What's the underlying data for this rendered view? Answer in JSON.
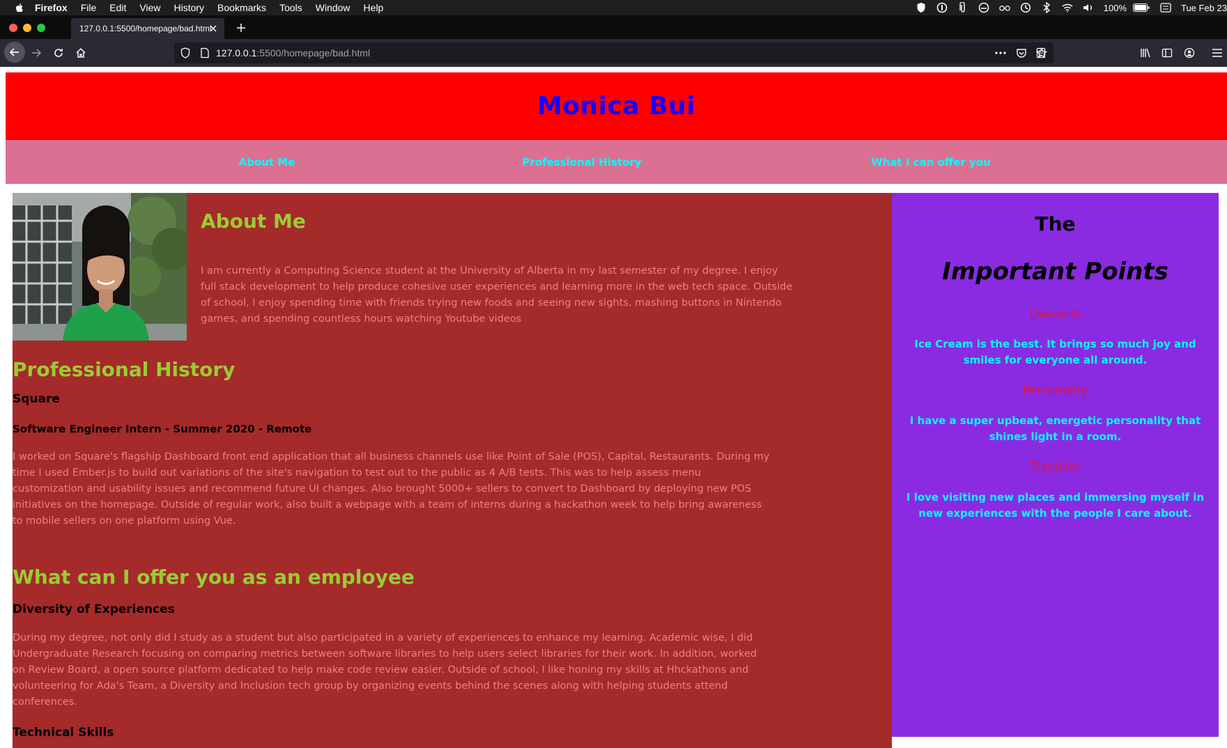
{
  "os_menubar": {
    "app_name": "Firefox",
    "menus": [
      "File",
      "Edit",
      "View",
      "History",
      "Bookmarks",
      "Tools",
      "Window",
      "Help"
    ],
    "battery_percent": "100%",
    "clock": "Tue Feb 23",
    "status_icons": [
      "ublock-icon",
      "1password-icon",
      "paperclip-icon",
      "creative-cloud-icon",
      "glasses-icon",
      "time-machine-icon",
      "bluetooth-icon",
      "wifi-icon",
      "volume-icon",
      "battery-icon",
      "keyboard-icon"
    ]
  },
  "browser": {
    "tab_title": "127.0.0.1:5500/homepage/bad.html",
    "url_host": "127.0.0.1",
    "url_rest": ":5500/homepage/bad.html"
  },
  "site": {
    "header_title": "Monica Bui",
    "nav": [
      "About Me",
      "Professional History",
      "What I can offer you"
    ],
    "about_heading": "About Me",
    "about_text": "I am currently a Computing Science student at the University of Alberta in my last semester of my degree. I enjoy full stack development to help produce cohesive user experiences and learning more in the web tech space. Outside of school, I enjoy spending time with friends trying new foods and seeing new sights, mashing buttons in Nintendo games, and spending countless hours watching Youtube videos",
    "prof_heading": "Professional History",
    "prof_company": "Square",
    "prof_role": "Software Engineer Intern - Summer 2020 - Remote",
    "prof_text": "I worked on Square's flagship Dashboard front end application that all business channels use like Point of Sale (POS), Capital, Restaurants. During my time I used Ember.js to build out variations of the site's navigation to test out to the public as 4 A/B tests. This was to help assess menu customization and usability issues and recommend future UI changes. Also brought 5000+ sellers to convert to Dashboard by deploying new POS initiatives on the homepage. Outside of regular work, also built a webpage with a team of interns during a hackathon week to help bring awareness to mobile sellers on one platform using Vue.",
    "offer_heading": "What can I offer you as an employee",
    "offer_sub": "Diversity of Experiences",
    "offer_text": "During my degree, not only did I study as a student but also participated in a variety of experiences to enhance my learning. Academic wise, I did Undergraduate Research focusing on comparing metrics between software libraries to help users select libraries for their work. In addition, worked on Review Board, a open source platform dedicated to help make code review easier. Outside of school, I like honing my skills at Hhckathons and volunteering for Ada's Team, a Diversity and Inclusion tech group by organizing events behind the scenes along with helping students attend conferences.",
    "tech_heading": "Technical Skills",
    "sidebar": {
      "the": "The",
      "important": "Important Points",
      "points": [
        {
          "title": "Desserts",
          "text": "Ice Cream is the best. It brings so much joy and smiles for everyone all around."
        },
        {
          "title": "Personality",
          "text": "I have a super upbeat, energetic personality that shines light in a room."
        },
        {
          "title": "Traveller",
          "text": "I love visiting new places and immersing myself in new experiences with the people I care about."
        }
      ]
    }
  },
  "colors": {
    "header_bg": "#ff0000",
    "header_text": "#1a00ff",
    "nav_bg": "#db7093",
    "nav_text": "#00ffff",
    "main_bg": "#a52a2a",
    "heading": "#9acd32",
    "body_text": "#f08080",
    "sidebar_bg": "#8a2be2",
    "sidebar_point_title": "#dc143c",
    "sidebar_point_text": "#00ffff"
  }
}
